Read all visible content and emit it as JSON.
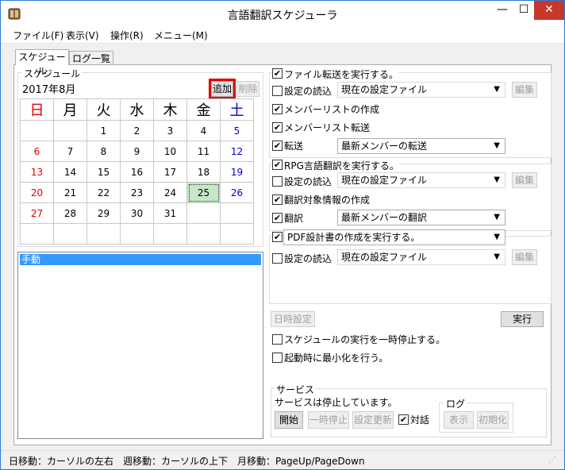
{
  "window": {
    "title": "言語翻訳スケジューラ",
    "minimize": "—",
    "maximize": "☐",
    "close": "✕"
  },
  "menu": [
    "ファイル(F)",
    "表示(V)",
    "操作(R)",
    "メニュー(M)"
  ],
  "tabs": [
    "スケジュール",
    "ログ一覧"
  ],
  "schedule": {
    "group_label": "スケジュール",
    "month": "2017年8月",
    "add_button": "追加",
    "delete_button": "削除",
    "weekdays": [
      "日",
      "月",
      "火",
      "水",
      "木",
      "金",
      "土"
    ],
    "weeks": [
      [
        "",
        "",
        "1",
        "2",
        "3",
        "4",
        "5"
      ],
      [
        "6",
        "7",
        "8",
        "9",
        "10",
        "11",
        "12"
      ],
      [
        "13",
        "14",
        "15",
        "16",
        "17",
        "18",
        "19"
      ],
      [
        "20",
        "21",
        "22",
        "23",
        "24",
        "25",
        "26"
      ],
      [
        "27",
        "28",
        "29",
        "30",
        "31",
        "",
        ""
      ],
      [
        "",
        "",
        "",
        "",
        "",
        "",
        ""
      ]
    ],
    "selected_day": "25",
    "list_items": [
      "手動"
    ]
  },
  "transfer": {
    "header": "ファイル転送を実行する。",
    "load_settings": "設定の読込",
    "settings_file": "現在の設定ファイル",
    "edit": "編集",
    "member_list_create": "メンバーリストの作成",
    "member_list_transfer": "メンバーリスト転送",
    "transfer_label": "転送",
    "transfer_option": "最新メンバーの転送"
  },
  "rpg": {
    "header": "RPG言語翻訳を実行する。",
    "load_settings": "設定の読込",
    "settings_file": "現在の設定ファイル",
    "edit": "編集",
    "target_info": "翻訳対象情報の作成",
    "translate_label": "翻訳",
    "translate_option": "最新メンバーの翻訳"
  },
  "pdf": {
    "header": "PDF設計書の作成を実行する。",
    "load_settings": "設定の読込",
    "settings_file": "現在の設定ファイル",
    "edit": "編集"
  },
  "controls": {
    "datetime_settings": "日時設定",
    "execute": "実行",
    "pause_schedule": "スケジュールの実行を一時停止する。",
    "minimize_on_start": "起動時に最小化を行う。"
  },
  "service": {
    "label": "サービス",
    "status": "サービスは停止しています。",
    "start": "開始",
    "pause": "一時停止",
    "update_settings": "設定更新",
    "dialog": "対話",
    "log_label": "ログ",
    "log_show": "表示",
    "log_init": "初期化"
  },
  "statusbar": "日移動：カーソルの左右　週移動：カーソルの上下　月移動：PageUp/PageDown",
  "colors": {
    "sunday": "#e00000",
    "saturday": "#0000cc",
    "highlight": "#e00000",
    "selected_bg": "#c8e6c8",
    "list_selected": "#3399ff"
  }
}
